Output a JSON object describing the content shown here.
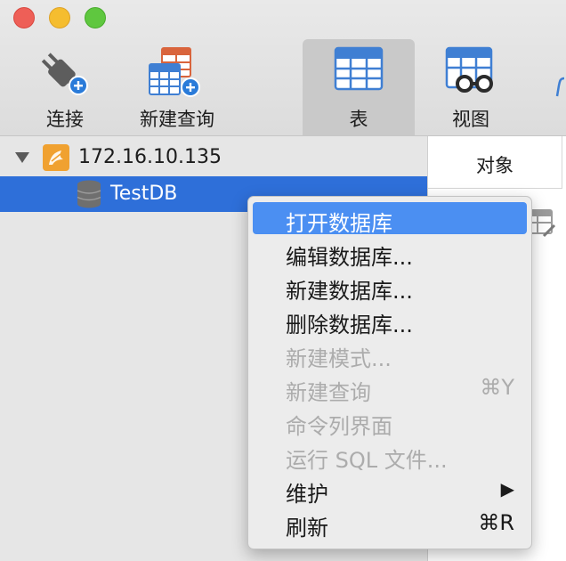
{
  "toolbar": {
    "connect_label": "连接",
    "new_query_label": "新建查询",
    "table_label": "表",
    "view_label": "视图"
  },
  "sidebar": {
    "server": {
      "label": "172.16.10.135",
      "expanded": true,
      "icon": "mysql-server-icon"
    },
    "database": {
      "label": "TestDB",
      "selected": true,
      "icon": "database-icon"
    }
  },
  "right_pane": {
    "tab_label": "对象"
  },
  "context_menu": {
    "items": [
      {
        "label": "打开数据库",
        "shortcut": "",
        "enabled": true,
        "highlighted": true
      },
      {
        "label": "编辑数据库...",
        "shortcut": "",
        "enabled": true
      },
      {
        "label": "新建数据库...",
        "shortcut": "",
        "enabled": true
      },
      {
        "label": "删除数据库...",
        "shortcut": "",
        "enabled": true
      },
      {
        "label": "新建模式...",
        "shortcut": "",
        "enabled": false
      },
      {
        "label": "新建查询",
        "shortcut": "⌘Y",
        "enabled": false
      },
      {
        "label": "命令列界面",
        "shortcut": "",
        "enabled": false
      },
      {
        "label": "运行 SQL 文件...",
        "shortcut": "",
        "enabled": false
      },
      {
        "label": "维护",
        "shortcut": "▶",
        "enabled": true,
        "submenu": true
      },
      {
        "label": "刷新",
        "shortcut": "⌘R",
        "enabled": true
      }
    ]
  },
  "colors": {
    "selection": "#2e6fd9",
    "menu_highlight": "#4b8ff2",
    "table_icon_blue": "#3f7fd3",
    "query_icon_red": "#d9643c"
  }
}
